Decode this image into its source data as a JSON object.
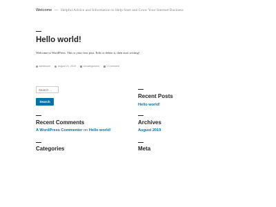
{
  "site": {
    "title": "Welcome",
    "separator": "—",
    "description": "Helpful Advice and Information to Help Start and Grow Your Internet Business"
  },
  "post": {
    "title": "Hello world!",
    "content": "Welcome to WordPress. This is your first post. Edit or delete it, then start writing!",
    "meta": {
      "author": "adminuser",
      "date": "August 21, 2019",
      "category": "Uncategorized",
      "comments": "1 Comment"
    }
  },
  "search": {
    "placeholder": "Search …",
    "button_label": "Search"
  },
  "widgets": {
    "recent_posts": {
      "title": "Recent Posts",
      "items": [
        "Hello world!"
      ]
    },
    "recent_comments": {
      "title": "Recent Comments",
      "author": "A WordPress Commenter",
      "on": "on",
      "post": "Hello world!"
    },
    "archives": {
      "title": "Archives",
      "items": [
        "August 2019"
      ]
    },
    "categories": {
      "title": "Categories"
    },
    "meta": {
      "title": "Meta"
    }
  },
  "colors": {
    "link": "#0073aa",
    "button": "#0073aa",
    "text": "#222222"
  }
}
